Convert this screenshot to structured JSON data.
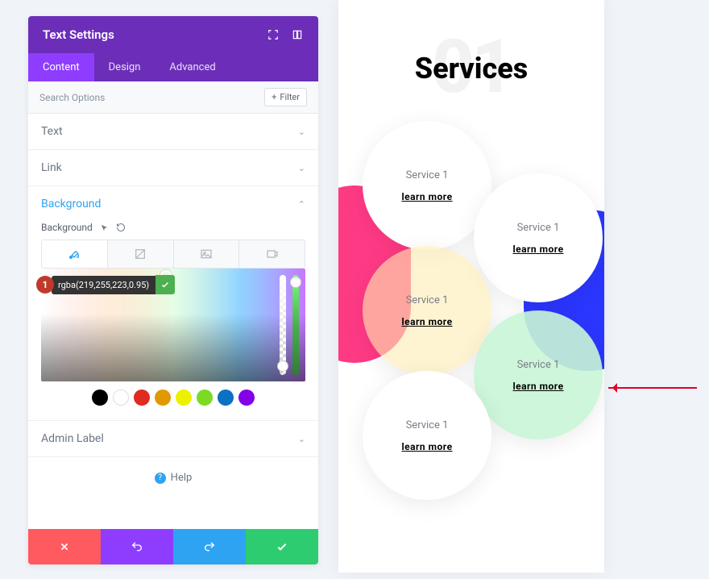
{
  "panel": {
    "title": "Text Settings",
    "tabs": [
      "Content",
      "Design",
      "Advanced"
    ],
    "active_tab": 0,
    "search_placeholder": "Search Options",
    "filter_label": "Filter",
    "sections": {
      "text": {
        "title": "Text"
      },
      "link": {
        "title": "Link"
      },
      "background": {
        "title": "Background",
        "field_label": "Background",
        "color_value": "rgba(219,255,223,0.95)",
        "swatches": [
          "#000000",
          "#ffffff",
          "#e02b20",
          "#e09900",
          "#edf000",
          "#7cda24",
          "#0c71c3",
          "#8300e9"
        ]
      },
      "admin_label": {
        "title": "Admin Label"
      }
    },
    "help_label": "Help",
    "badge_number": "1"
  },
  "preview": {
    "big_number": "01",
    "heading": "Services",
    "bubbles": [
      {
        "title": "Service 1",
        "link": "learn more"
      },
      {
        "title": "Service 1",
        "link": "learn more"
      },
      {
        "title": "Service 1",
        "link": "learn more"
      },
      {
        "title": "Service 1",
        "link": "learn more"
      },
      {
        "title": "Service 1",
        "link": "learn more"
      }
    ],
    "accent_pink": "#ff2f7e",
    "accent_blue": "#2b36ff"
  }
}
